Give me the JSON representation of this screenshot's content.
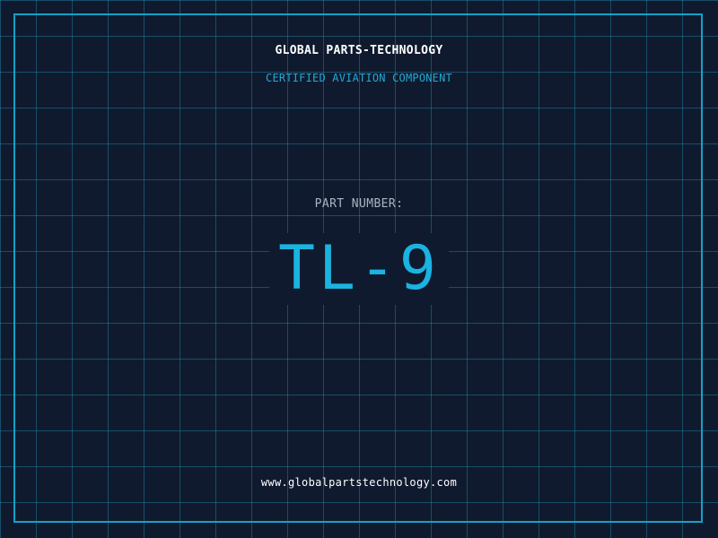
{
  "header": {
    "company": "GLOBAL PARTS-TECHNOLOGY",
    "certification": "CERTIFIED AVIATION COMPONENT"
  },
  "part": {
    "label": "PART NUMBER:",
    "number": "TL-9"
  },
  "footer": {
    "website": "www.globalpartstechnology.com"
  },
  "colors": {
    "background": "#101a2e",
    "grid": "#2296b4",
    "accent": "#1bb3e0",
    "frame": "#12a2c9",
    "text": "#ffffff",
    "muted": "#a9b4c3"
  }
}
